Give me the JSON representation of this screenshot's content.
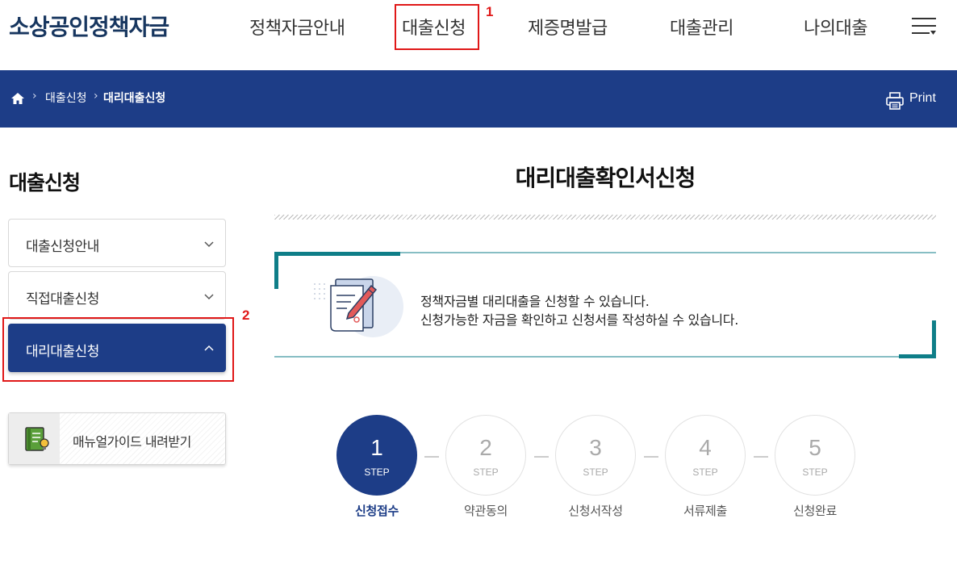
{
  "header": {
    "logo": "소상공인정책자금",
    "nav": [
      "정책자금안내",
      "대출신청",
      "제증명발급",
      "대출관리",
      "나의대출"
    ],
    "annotation_1": "1"
  },
  "breadcrumb": {
    "items": [
      "대출신청",
      "대리대출신청"
    ],
    "print_label": "Print"
  },
  "sidebar": {
    "title": "대출신청",
    "items": [
      {
        "label": "대출신청안내",
        "expanded": false
      },
      {
        "label": "직접대출신청",
        "expanded": false
      },
      {
        "label": "대리대출신청",
        "expanded": true
      }
    ],
    "annotation_2": "2",
    "manual_button": "매뉴얼가이드 내려받기"
  },
  "main": {
    "title": "대리대출확인서신청",
    "info_lines": [
      "정책자금별 대리대출을 신청할 수 있습니다.",
      "신청가능한 자금을 확인하고 신청서를 작성하실 수 있습니다."
    ],
    "steps": [
      {
        "num": "1",
        "sub": "STEP",
        "label": "신청접수",
        "active": true
      },
      {
        "num": "2",
        "sub": "STEP",
        "label": "약관동의",
        "active": false
      },
      {
        "num": "3",
        "sub": "STEP",
        "label": "신청서작성",
        "active": false
      },
      {
        "num": "4",
        "sub": "STEP",
        "label": "서류제출",
        "active": false
      },
      {
        "num": "5",
        "sub": "STEP",
        "label": "신청완료",
        "active": false
      }
    ]
  },
  "colors": {
    "primary": "#1d3d87",
    "teal": "#0f7e88",
    "highlight": "#e01818"
  }
}
